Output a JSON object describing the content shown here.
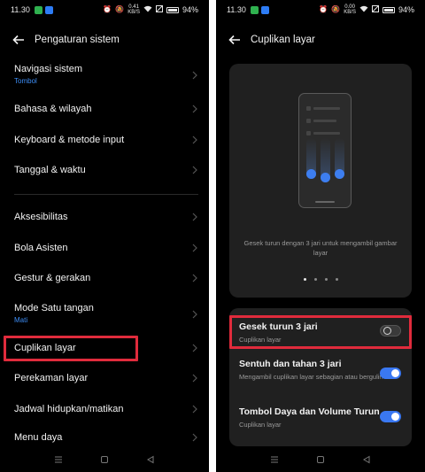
{
  "left": {
    "status": {
      "time": "11.30",
      "speed_top": "0.41",
      "speed_bottom": "KB/S",
      "battery": "94%"
    },
    "header": {
      "title": "Pengaturan sistem"
    },
    "items": [
      {
        "label": "Navigasi sistem",
        "sub": "Tombol"
      },
      {
        "label": "Bahasa & wilayah"
      },
      {
        "label": "Keyboard & metode input"
      },
      {
        "label": "Tanggal & waktu"
      },
      {
        "label": "Aksesibilitas"
      },
      {
        "label": "Bola Asisten"
      },
      {
        "label": "Gestur & gerakan"
      },
      {
        "label": "Mode Satu tangan",
        "sub": "Mati"
      },
      {
        "label": "Cuplikan layar"
      },
      {
        "label": "Perekaman layar"
      },
      {
        "label": "Jadwal hidupkan/matikan"
      },
      {
        "label": "Menu daya"
      }
    ]
  },
  "right": {
    "status": {
      "time": "11.30",
      "speed_top": "0.00",
      "speed_bottom": "KB/S",
      "battery": "94%"
    },
    "header": {
      "title": "Cuplikan layar"
    },
    "preview": {
      "caption": "Gesek turun dengan 3 jari untuk mengambil gambar layar",
      "page_count": 4,
      "active_page": 1
    },
    "options": [
      {
        "title": "Gesek turun 3 jari",
        "desc": "Cuplikan layar",
        "enabled": false
      },
      {
        "title": "Sentuh dan tahan 3 jari",
        "desc": "Mengambil cuplikan layar sebagian atau bergulir.",
        "enabled": true
      },
      {
        "title": "Tombol Daya dan Volume Turun",
        "desc": "Cuplikan layar",
        "enabled": true
      }
    ]
  },
  "colors": {
    "accent": "#3a78f2",
    "highlight": "#e02b3c",
    "sub_text_blue": "#3d8df5",
    "card": "#202020"
  }
}
